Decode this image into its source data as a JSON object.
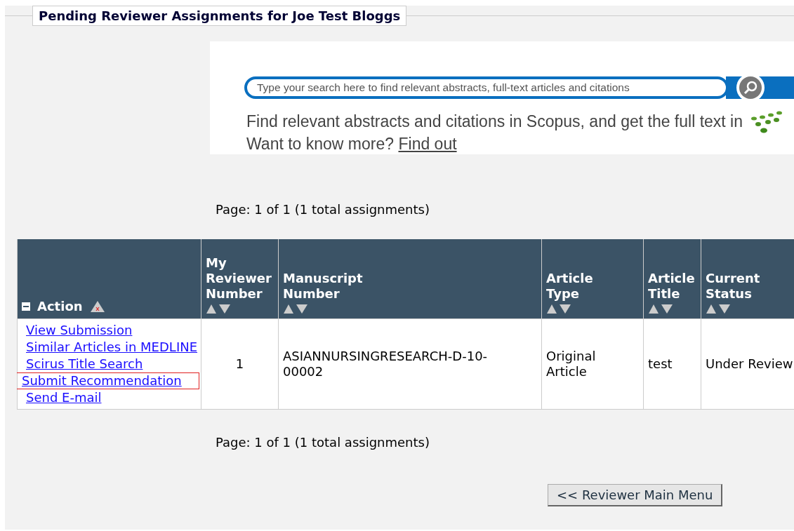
{
  "panel": {
    "title": "Pending Reviewer Assignments for Joe Test Bloggs"
  },
  "banner": {
    "search": {
      "placeholder": "Type your search here to find relevant abstracts, full-text articles and citations"
    },
    "description": "Find relevant abstracts and citations in Scopus, and get the full text in",
    "prompt": "Want to know more?",
    "link": "Find out"
  },
  "pager_top": "Page: 1 of 1 (1 total assignments)",
  "table": {
    "columns": [
      {
        "label": "Action",
        "kind": "action"
      },
      {
        "label": "My Reviewer Number",
        "kind": "sortable"
      },
      {
        "label": "Manuscript Number",
        "kind": "sortable"
      },
      {
        "label": "Article Type",
        "kind": "sortable"
      },
      {
        "label": "Article Title",
        "kind": "sortable"
      },
      {
        "label": "Current Status",
        "kind": "sortable"
      }
    ],
    "rows": [
      {
        "cells": [
          {
            "links": [
              {
                "label": "View Submission",
                "highlighted": false
              },
              {
                "label": "Similar Articles in MEDLINE",
                "highlighted": false
              },
              {
                "label": "Scirus Title Search",
                "highlighted": false
              },
              {
                "label": "Submit Recommendation",
                "highlighted": true
              },
              {
                "label": "Send E-mail",
                "highlighted": false
              }
            ]
          },
          "1",
          "ASIANNURSINGRESEARCH-D-10-00002",
          "Original Article",
          "test",
          "Under Review"
        ]
      }
    ]
  },
  "pager_bottom": "Page: 1 of 1 (1 total assignments)",
  "back_button": "<< Reviewer Main Menu"
}
